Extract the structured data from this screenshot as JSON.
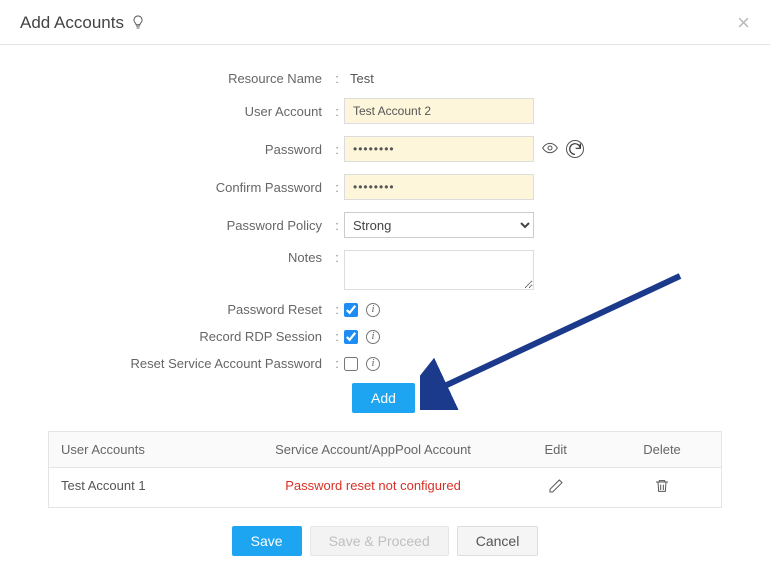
{
  "header": {
    "title": "Add Accounts"
  },
  "form": {
    "resource_name_label": "Resource Name",
    "resource_name_value": "Test",
    "user_account_label": "User Account",
    "user_account_value": "Test Account 2",
    "password_label": "Password",
    "password_value": "••••••••",
    "confirm_password_label": "Confirm Password",
    "confirm_password_value": "••••••••",
    "password_policy_label": "Password Policy",
    "password_policy_value": "Strong",
    "notes_label": "Notes",
    "notes_value": "",
    "password_reset_label": "Password Reset",
    "password_reset_checked": true,
    "record_rdp_label": "Record RDP Session",
    "record_rdp_checked": true,
    "reset_svc_label": "Reset Service Account Password",
    "reset_svc_checked": false,
    "add_label": "Add"
  },
  "table": {
    "headers": {
      "user_accounts": "User Accounts",
      "service_account": "Service Account/AppPool Account",
      "edit": "Edit",
      "delete": "Delete"
    },
    "rows": [
      {
        "user": "Test Account 1",
        "service": "Password reset not configured"
      }
    ]
  },
  "footer": {
    "save": "Save",
    "save_proceed": "Save & Proceed",
    "cancel": "Cancel"
  }
}
